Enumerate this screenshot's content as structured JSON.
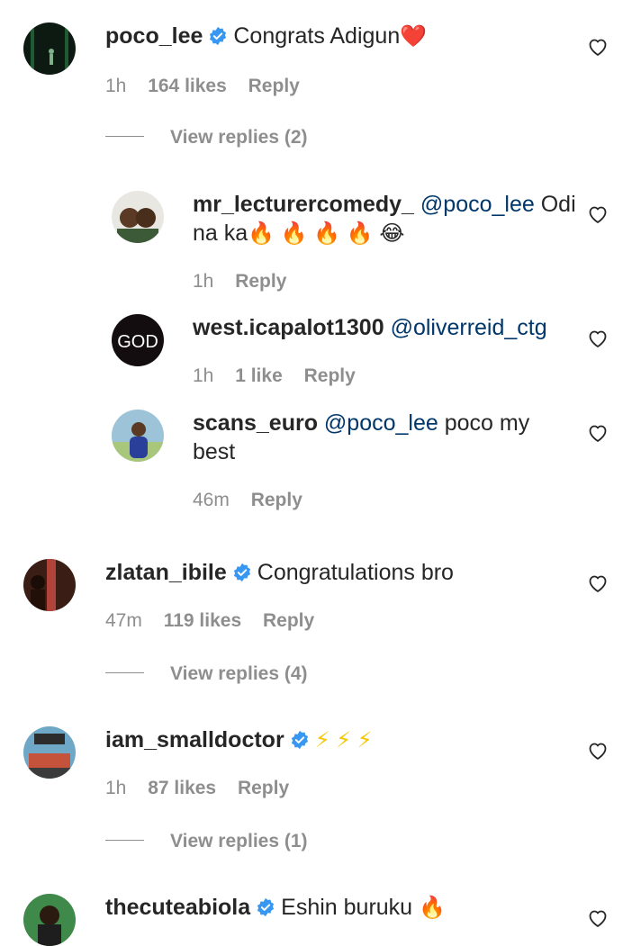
{
  "comments": [
    {
      "username": "poco_lee",
      "verified": true,
      "text": "Congrats Adigun",
      "emoji": "❤️",
      "time": "1h",
      "likes": "164 likes",
      "reply": "Reply",
      "view_replies": "View replies (2)",
      "replies": [
        {
          "username": "mr_lecturercomedy_",
          "mention": "@poco_lee",
          "text": "Odi na ka",
          "emoji": "🔥 🔥 🔥 🔥 😂",
          "time": "1h",
          "reply": "Reply"
        },
        {
          "username": "west.icapalot1300",
          "mention": "@oliverreid_ctg",
          "text": "",
          "avatar_text": "GOD",
          "time": "1h",
          "likes": "1 like",
          "reply": "Reply"
        },
        {
          "username": "scans_euro",
          "mention": "@poco_lee",
          "text": "poco my best",
          "time": "46m",
          "reply": "Reply"
        }
      ]
    },
    {
      "username": "zlatan_ibile",
      "verified": true,
      "text": "Congratulations bro",
      "time": "47m",
      "likes": "119 likes",
      "reply": "Reply",
      "view_replies": "View replies (4)"
    },
    {
      "username": "iam_smalldoctor",
      "verified": true,
      "text": "",
      "emoji": "⚡ ⚡ ⚡",
      "time": "1h",
      "likes": "87 likes",
      "reply": "Reply",
      "view_replies": "View replies (1)"
    },
    {
      "username": "thecuteabiola",
      "verified": true,
      "text": "Eshin buruku",
      "emoji": "🔥"
    }
  ],
  "colors": {
    "text": "#262626",
    "secondary": "#8e8e8e",
    "mention": "#00376b",
    "verified": "#3897f0"
  },
  "icons": {
    "verified": "verified-badge-icon",
    "like": "heart-outline-icon"
  }
}
